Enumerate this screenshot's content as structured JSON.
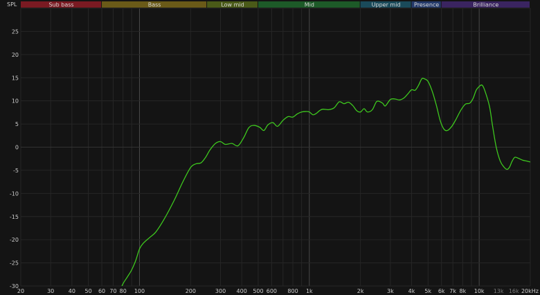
{
  "chart_data": {
    "type": "line",
    "ylabel": "SPL",
    "x_scale": "log",
    "xlim": [
      20,
      20000
    ],
    "ylim": [
      -30,
      30
    ],
    "grid": true,
    "y_ticks": [
      25,
      20,
      15,
      10,
      5,
      0,
      -5,
      -10,
      -15,
      -20,
      -25,
      -30
    ],
    "x_ticks": [
      {
        "v": 20,
        "label": "20"
      },
      {
        "v": 30,
        "label": "30"
      },
      {
        "v": 40,
        "label": "40"
      },
      {
        "v": 50,
        "label": "50"
      },
      {
        "v": 60,
        "label": "60"
      },
      {
        "v": 70,
        "label": "70"
      },
      {
        "v": 80,
        "label": "80"
      },
      {
        "v": 100,
        "label": "100"
      },
      {
        "v": 200,
        "label": "200"
      },
      {
        "v": 300,
        "label": "300"
      },
      {
        "v": 400,
        "label": "400"
      },
      {
        "v": 500,
        "label": "500"
      },
      {
        "v": 600,
        "label": "600"
      },
      {
        "v": 800,
        "label": "800"
      },
      {
        "v": 1000,
        "label": "1k"
      },
      {
        "v": 2000,
        "label": "2k"
      },
      {
        "v": 3000,
        "label": "3k"
      },
      {
        "v": 4000,
        "label": "4k"
      },
      {
        "v": 5000,
        "label": "5k"
      },
      {
        "v": 6000,
        "label": "6k"
      },
      {
        "v": 7000,
        "label": "7k"
      },
      {
        "v": 8000,
        "label": "8k"
      },
      {
        "v": 10000,
        "label": "10k"
      },
      {
        "v": 13000,
        "label": "13k",
        "dim": true
      },
      {
        "v": 16000,
        "label": "16k",
        "dim": true
      },
      {
        "v": 20000,
        "label": "20kHz"
      }
    ],
    "bands": [
      {
        "label": "Sub bass",
        "from": 20,
        "to": 60,
        "color": "#7a1a22"
      },
      {
        "label": "Bass",
        "from": 60,
        "to": 250,
        "color": "#6a5a18"
      },
      {
        "label": "Low mid",
        "from": 250,
        "to": 500,
        "color": "#4a5a18"
      },
      {
        "label": "Mid",
        "from": 500,
        "to": 2000,
        "color": "#1d5a28"
      },
      {
        "label": "Upper mid",
        "from": 2000,
        "to": 4000,
        "color": "#1a4a5a"
      },
      {
        "label": "Presence",
        "from": 4000,
        "to": 6000,
        "color": "#243a6a"
      },
      {
        "label": "Brilliance",
        "from": 6000,
        "to": 20000,
        "color": "#3a2460"
      }
    ],
    "series": [
      {
        "color": "#3ec81e",
        "points": [
          [
            77,
            -31
          ],
          [
            80,
            -29.5
          ],
          [
            85,
            -28
          ],
          [
            90,
            -26.5
          ],
          [
            95,
            -24.5
          ],
          [
            100,
            -22
          ],
          [
            105,
            -20.8
          ],
          [
            115,
            -19.5
          ],
          [
            125,
            -18.3
          ],
          [
            140,
            -15.5
          ],
          [
            160,
            -11.5
          ],
          [
            180,
            -7.5
          ],
          [
            200,
            -4.4
          ],
          [
            215,
            -3.6
          ],
          [
            230,
            -3.4
          ],
          [
            245,
            -2.2
          ],
          [
            260,
            -0.6
          ],
          [
            280,
            0.8
          ],
          [
            300,
            1.2
          ],
          [
            320,
            0.6
          ],
          [
            350,
            0.8
          ],
          [
            380,
            0.3
          ],
          [
            410,
            2.0
          ],
          [
            440,
            4.2
          ],
          [
            470,
            4.7
          ],
          [
            510,
            4.3
          ],
          [
            540,
            3.6
          ],
          [
            570,
            4.8
          ],
          [
            610,
            5.3
          ],
          [
            650,
            4.5
          ],
          [
            700,
            5.8
          ],
          [
            750,
            6.6
          ],
          [
            800,
            6.5
          ],
          [
            850,
            7.2
          ],
          [
            900,
            7.6
          ],
          [
            950,
            7.7
          ],
          [
            1000,
            7.6
          ],
          [
            1050,
            7.0
          ],
          [
            1100,
            7.3
          ],
          [
            1150,
            7.9
          ],
          [
            1200,
            8.2
          ],
          [
            1300,
            8.1
          ],
          [
            1400,
            8.5
          ],
          [
            1500,
            9.8
          ],
          [
            1600,
            9.4
          ],
          [
            1700,
            9.7
          ],
          [
            1800,
            9.0
          ],
          [
            1900,
            7.9
          ],
          [
            2000,
            7.6
          ],
          [
            2100,
            8.3
          ],
          [
            2200,
            7.6
          ],
          [
            2350,
            8.1
          ],
          [
            2500,
            9.9
          ],
          [
            2700,
            9.5
          ],
          [
            2800,
            8.9
          ],
          [
            3000,
            10.3
          ],
          [
            3200,
            10.4
          ],
          [
            3400,
            10.2
          ],
          [
            3600,
            10.6
          ],
          [
            3800,
            11.5
          ],
          [
            4000,
            12.4
          ],
          [
            4200,
            12.3
          ],
          [
            4400,
            13.4
          ],
          [
            4600,
            14.8
          ],
          [
            4800,
            14.7
          ],
          [
            5000,
            14.2
          ],
          [
            5300,
            12.0
          ],
          [
            5600,
            9.0
          ],
          [
            5900,
            5.7
          ],
          [
            6200,
            3.9
          ],
          [
            6500,
            3.6
          ],
          [
            6900,
            4.5
          ],
          [
            7300,
            6.0
          ],
          [
            7800,
            8.0
          ],
          [
            8300,
            9.3
          ],
          [
            8800,
            9.5
          ],
          [
            9200,
            10.5
          ],
          [
            9600,
            12.3
          ],
          [
            10000,
            13.1
          ],
          [
            10400,
            13.4
          ],
          [
            10800,
            12.2
          ],
          [
            11500,
            8.8
          ],
          [
            12000,
            4.5
          ],
          [
            12600,
            0.0
          ],
          [
            13300,
            -3.0
          ],
          [
            14000,
            -4.3
          ],
          [
            14600,
            -4.8
          ],
          [
            15100,
            -4.3
          ],
          [
            15600,
            -3.1
          ],
          [
            16200,
            -2.2
          ],
          [
            17000,
            -2.4
          ],
          [
            18000,
            -2.8
          ],
          [
            19000,
            -3.0
          ],
          [
            20000,
            -3.2
          ]
        ]
      }
    ]
  }
}
